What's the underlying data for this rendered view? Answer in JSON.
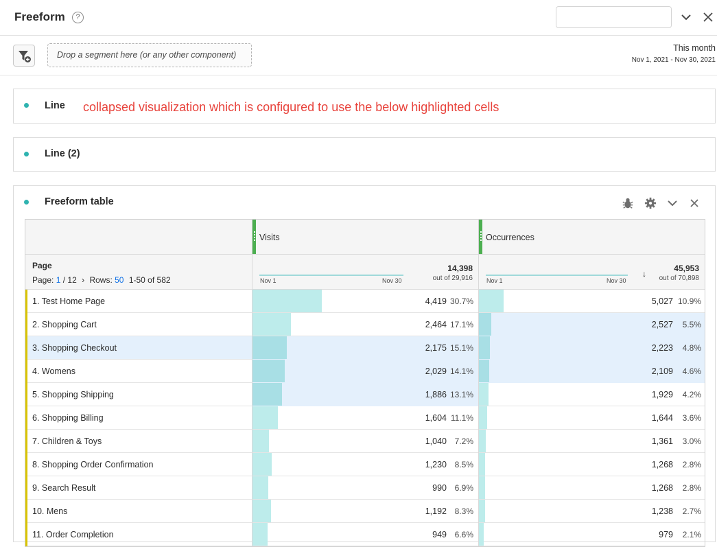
{
  "header": {
    "title": "Freeform",
    "help_glyph": "?"
  },
  "segment_bar": {
    "dropzone_placeholder": "Drop a segment here (or any other component)",
    "date_label": "This month",
    "date_range": "Nov 1, 2021 - Nov 30, 2021"
  },
  "panels": {
    "line1": {
      "title": "Line",
      "annotation": "collapsed visualization which is configured to use the below highlighted cells"
    },
    "line2": {
      "title": "Line (2)"
    },
    "freeform": {
      "title": "Freeform table"
    }
  },
  "table": {
    "dimension": "Page",
    "pager_prefix": "Page:",
    "page_current": "1",
    "page_total": "/ 12",
    "rows_label": "Rows:",
    "rows_value": "50",
    "range": "1-50 of 582",
    "columns": [
      {
        "label": "Visits",
        "spark_start": "Nov 1",
        "spark_end": "Nov 30",
        "total": "14,398",
        "out_of": "out of 29,916"
      },
      {
        "label": "Occurrences",
        "spark_start": "Nov 1",
        "spark_end": "Nov 30",
        "total": "45,953",
        "out_of": "out of 70,898",
        "sort": "↓"
      }
    ],
    "rows": [
      {
        "name": "1.  Test Home Page",
        "v": "4,419",
        "vp": "30.7%",
        "vf": 0.307,
        "o": "5,027",
        "op": "10.9%",
        "of": 0.109,
        "hl_v": false,
        "hl_o": false
      },
      {
        "name": "2.  Shopping Cart",
        "v": "2,464",
        "vp": "17.1%",
        "vf": 0.171,
        "o": "2,527",
        "op": "5.5%",
        "of": 0.055,
        "hl_v": false,
        "hl_o": true
      },
      {
        "name": "3.  Shopping Checkout",
        "v": "2,175",
        "vp": "15.1%",
        "vf": 0.151,
        "o": "2,223",
        "op": "4.8%",
        "of": 0.048,
        "hl_v": true,
        "hl_o": true,
        "hl_name": true
      },
      {
        "name": "4.  Womens",
        "v": "2,029",
        "vp": "14.1%",
        "vf": 0.141,
        "o": "2,109",
        "op": "4.6%",
        "of": 0.046,
        "hl_v": true,
        "hl_o": true
      },
      {
        "name": "5.  Shopping Shipping",
        "v": "1,886",
        "vp": "13.1%",
        "vf": 0.131,
        "o": "1,929",
        "op": "4.2%",
        "of": 0.042,
        "hl_v": true,
        "hl_o": false
      },
      {
        "name": "6.  Shopping Billing",
        "v": "1,604",
        "vp": "11.1%",
        "vf": 0.111,
        "o": "1,644",
        "op": "3.6%",
        "of": 0.036,
        "hl_v": false,
        "hl_o": false
      },
      {
        "name": "7.  Children & Toys",
        "v": "1,040",
        "vp": "7.2%",
        "vf": 0.072,
        "o": "1,361",
        "op": "3.0%",
        "of": 0.03,
        "hl_v": false,
        "hl_o": false
      },
      {
        "name": "8.  Shopping Order Confirmation",
        "v": "1,230",
        "vp": "8.5%",
        "vf": 0.085,
        "o": "1,268",
        "op": "2.8%",
        "of": 0.028,
        "hl_v": false,
        "hl_o": false
      },
      {
        "name": "9.  Search Result",
        "v": "990",
        "vp": "6.9%",
        "vf": 0.069,
        "o": "1,268",
        "op": "2.8%",
        "of": 0.028,
        "hl_v": false,
        "hl_o": false
      },
      {
        "name": "10.  Mens",
        "v": "1,192",
        "vp": "8.3%",
        "vf": 0.083,
        "o": "1,238",
        "op": "2.7%",
        "of": 0.027,
        "hl_v": false,
        "hl_o": false
      },
      {
        "name": "11.  Order Completion",
        "v": "949",
        "vp": "6.6%",
        "vf": 0.066,
        "o": "979",
        "op": "2.1%",
        "of": 0.021,
        "hl_v": false,
        "hl_o": false
      }
    ]
  },
  "icons": [
    "help-icon",
    "chevron-down-icon",
    "close-icon",
    "filter-add-icon",
    "bug-icon",
    "gear-icon"
  ],
  "colors": {
    "accent_teal": "#2fb3b0",
    "bar_fill": "#bdeceb",
    "highlight": "#e4f0fc",
    "row_marker": "#d9c400",
    "column_grip": "#4caf50",
    "annotation": "#e8423b",
    "link_blue": "#1473e6"
  }
}
